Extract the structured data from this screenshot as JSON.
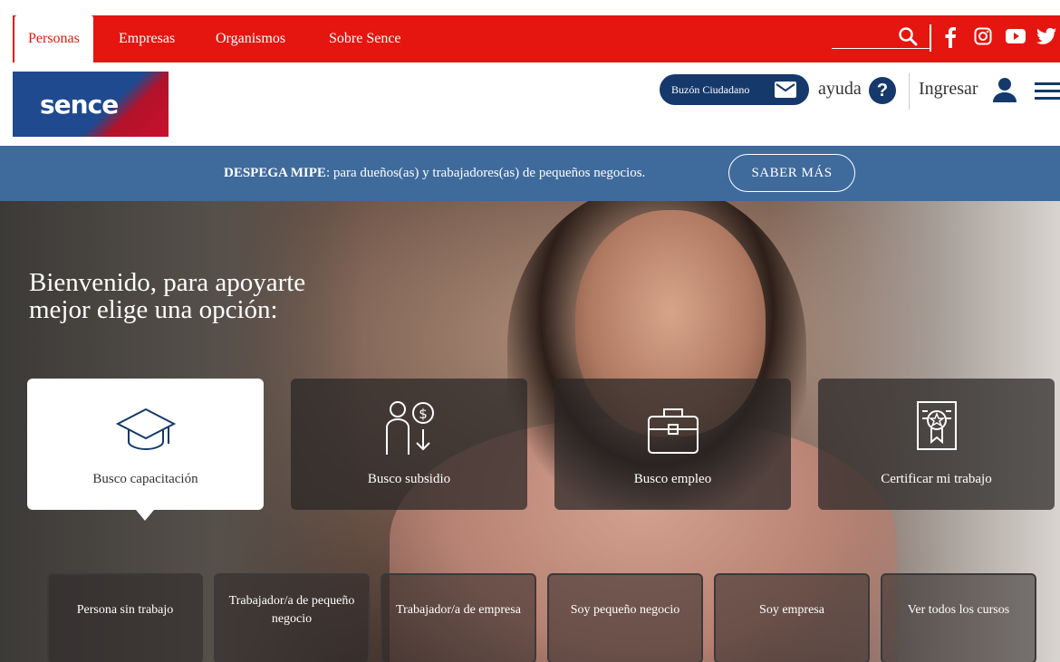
{
  "nav": {
    "tabs": [
      {
        "label": "Personas",
        "active": true
      },
      {
        "label": "Empresas",
        "active": false
      },
      {
        "label": "Organismos",
        "active": false
      },
      {
        "label": "Sobre Sence",
        "active": false
      }
    ],
    "icons": [
      "search-icon",
      "facebook-icon",
      "instagram-icon",
      "youtube-icon",
      "twitter-icon"
    ]
  },
  "header": {
    "logo_text": "sence",
    "buzon_label": "Buzón Ciudadano",
    "ayuda_label": "ayuda",
    "ingresar_label": "Ingresar"
  },
  "banner": {
    "bold": "DESPEGA MIPE",
    "text": ": para dueños(as) y trabajadores(as) de pequeños negocios.",
    "button": "SABER MÁS"
  },
  "hero": {
    "title": "Bienvenido, para apoyarte mejor elige una opción:",
    "cards": [
      {
        "label": "Busco capacitación",
        "icon": "graduation-cap-icon",
        "active": true
      },
      {
        "label": "Busco subsidio",
        "icon": "person-money-icon",
        "active": false
      },
      {
        "label": "Busco empleo",
        "icon": "briefcase-icon",
        "active": false
      },
      {
        "label": "Certificar mi trabajo",
        "icon": "certificate-icon",
        "active": false
      }
    ],
    "subcards": [
      "Persona sin trabajo",
      "Trabajador/a de pequeño negocio",
      "Trabajador/a de empresa",
      "Soy pequeño negocio",
      "Soy empresa",
      "Ver todos los cursos"
    ]
  },
  "colors": {
    "brand_red": "#e4160f",
    "brand_navy": "#15396b",
    "banner_blue": "#3f6a9c"
  }
}
